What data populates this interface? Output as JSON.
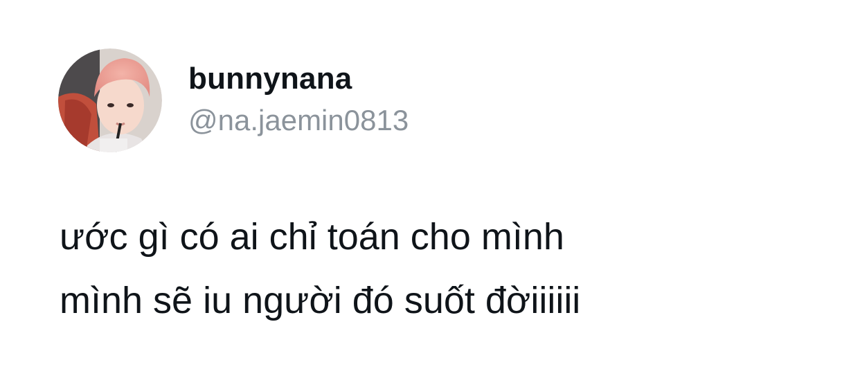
{
  "tweet": {
    "avatar_icon": "profile-photo",
    "display_name": "bunnynana",
    "handle": "@na.jaemin0813",
    "text_lines": [
      "ước gì có ai chỉ toán cho mình",
      "mình sẽ iu người đó suốt đờiiiiii"
    ]
  },
  "colors": {
    "background": "#ffffff",
    "text": "#0f1419",
    "handle": "#8b939b"
  }
}
